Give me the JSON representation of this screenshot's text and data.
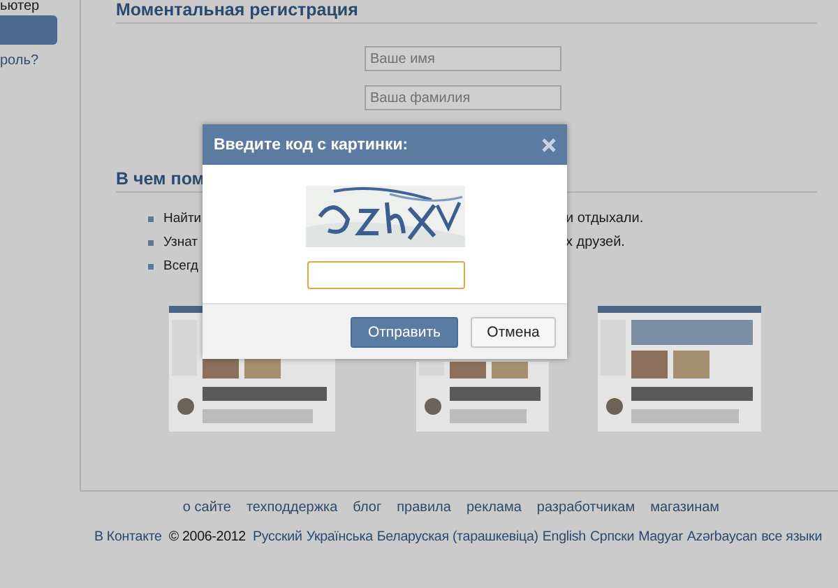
{
  "sidebar": {
    "top_text": "ьютер",
    "link": "роль?"
  },
  "registration": {
    "heading": "Моментальная регистрация",
    "first_name": {
      "placeholder": "Ваше имя"
    },
    "last_name": {
      "placeholder": "Ваша фамилия"
    }
  },
  "features": {
    "heading": "В чем пом",
    "bullets": [
      {
        "before": "Найти",
        "after": "и отдыхали."
      },
      {
        "before": "Узнат",
        "after": "х друзей."
      },
      {
        "before": "Всегд"
      }
    ]
  },
  "dialog": {
    "title": "Введите код с картинки:",
    "buttons": [
      {
        "label": "Отправить",
        "kind": "primary"
      },
      {
        "label": "Отмена",
        "kind": "secondary"
      }
    ]
  },
  "footer": {
    "links": [
      "о сайте",
      "техподдержка",
      "блог",
      "правила",
      "реклама",
      "разработчикам",
      "магазинам"
    ],
    "brand": "В Контакте",
    "copyright": "© 2006-2012",
    "languages": [
      "Русский",
      "Українська",
      "Беларуская (тарашкевіца)",
      "English",
      "Српски",
      "Magyar",
      "Azərbaycan",
      "все языки"
    ]
  }
}
